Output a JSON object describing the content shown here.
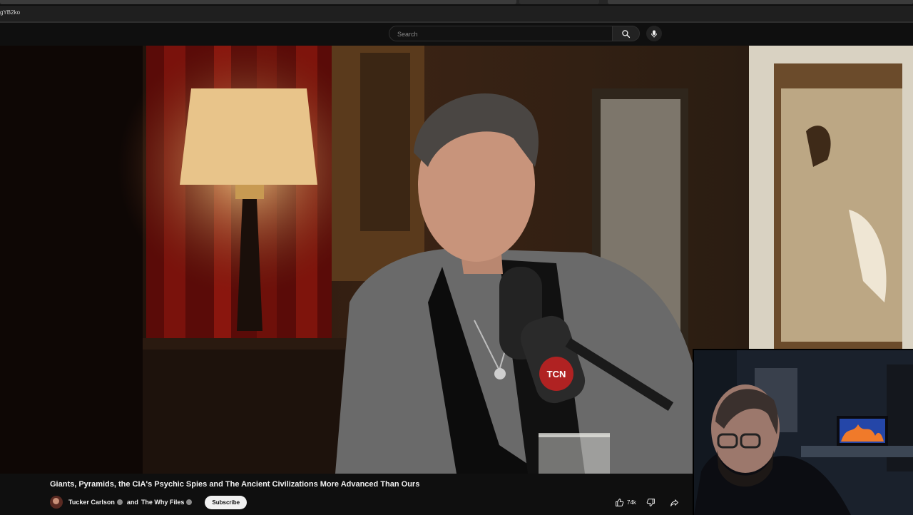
{
  "browser": {
    "url_fragment": "gYB2ko"
  },
  "youtube": {
    "search": {
      "placeholder": "Search",
      "value": ""
    },
    "icons": {
      "search": "search-icon",
      "mic": "mic-icon"
    }
  },
  "video": {
    "mic_badge_text": "TCN"
  },
  "info": {
    "title": "Giants, Pyramids, the CIA's Psychic Spies and The Ancient Civilizations More Advanced Than Ours",
    "channel_primary": "Tucker Carlson",
    "channel_joiner": "and",
    "channel_secondary": "The Why Files",
    "subscribe_label": "Subscribe",
    "likes": "74k",
    "icons": {
      "like": "thumbs-up-icon",
      "dislike": "thumbs-down-icon",
      "share": "share-icon"
    }
  }
}
